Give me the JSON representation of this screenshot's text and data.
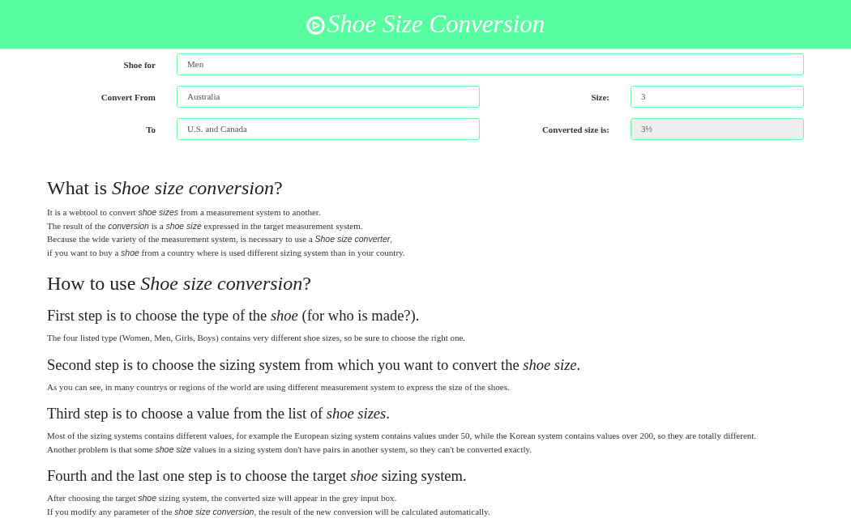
{
  "header": {
    "title": "Shoe Size Conversion"
  },
  "form": {
    "rows": [
      {
        "fields": [
          {
            "label": "Shoe for",
            "value": "Men",
            "readonly": false
          }
        ]
      },
      {
        "fields": [
          {
            "label": "Convert From",
            "value": "Australia",
            "readonly": false
          },
          {
            "label": "Size:",
            "value": "3",
            "readonly": false
          }
        ]
      },
      {
        "fields": [
          {
            "label": "To",
            "value": "U.S. and Canada",
            "readonly": false
          },
          {
            "label": "Converted size is:",
            "value": "3½",
            "readonly": true
          }
        ]
      }
    ]
  },
  "article": [
    {
      "kind": "heading",
      "text": "What is *Shoe size conversion*?"
    },
    {
      "kind": "paragraph",
      "lines": [
        "It is a webtool to convert *shoe sizes* from a measurement system to another.",
        "The result of the *conversion* is a *shoe size* expressed in the target measurement system.",
        "Because the wide variety of the measurement system, is necessary to use a *Shoe size converter*,",
        "if you want to buy a *shoe* from a country where is used different sizing system than in your country."
      ]
    },
    {
      "kind": "heading",
      "text": "How to use *Shoe size conversion*?"
    },
    {
      "kind": "subheading",
      "text": "First step is to choose the type of the *shoe* (for who is made?)."
    },
    {
      "kind": "paragraph",
      "lines": [
        "The four listed type (Women, Men, Girls, Boys) contains very different shoe sizes, so be sure to choose the right one."
      ]
    },
    {
      "kind": "subheading",
      "text": "Second step is to choose the sizing system from which you want to convert the *shoe size*."
    },
    {
      "kind": "paragraph",
      "lines": [
        "As you can see, in many countrys or regions of the world are using different measurement system to express the size of the shoes."
      ]
    },
    {
      "kind": "subheading",
      "text": "Third step is to choose a value from the list of *shoe sizes*."
    },
    {
      "kind": "paragraph",
      "lines": [
        "Most of the sizing systems contains different values, for example the European sizing system contains values under 50, while the Korean system contains values over 200, so they are totally different.",
        "Another problem is that some *shoe size* values in a sizing system don't have pairs in another system, so they can't be converted exactly."
      ]
    },
    {
      "kind": "subheading",
      "text": "Fourth and the last one step is to choose the target *shoe* sizing system."
    },
    {
      "kind": "paragraph",
      "lines": [
        "After choosing the target *shoe* sizing system, the converted size will appear in the grey input box.",
        "If you modify any parameter of the *shoe size conversion*, the result of the new conversion will be calculated automatically."
      ]
    }
  ]
}
